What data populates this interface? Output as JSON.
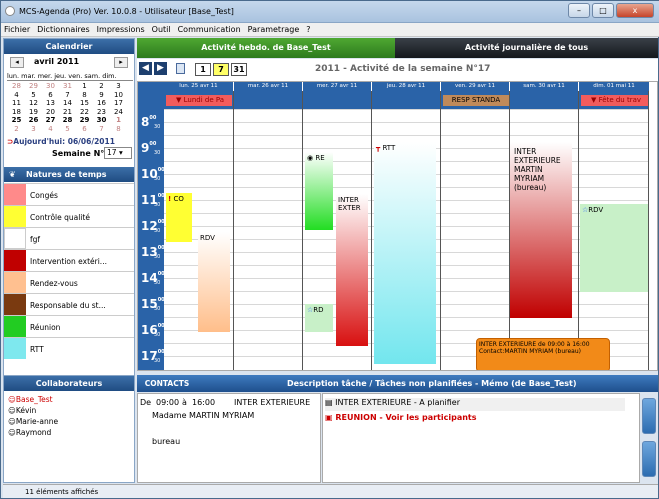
{
  "window": {
    "title": "MCS-Agenda (Pro) Ver. 10.0.8 - Utilisateur [Base_Test]",
    "min": "–",
    "max": "□",
    "close": "x"
  },
  "menu": [
    "Fichier",
    "Dictionnaires",
    "Impressions",
    "Outil",
    "Communication",
    "Parametrage",
    "?"
  ],
  "calendar": {
    "header": "Calendrier",
    "month": "avril 2011",
    "prev": "◂",
    "next": "▸",
    "dow": "lun. mar. mer. jeu. ven. sam. dim.",
    "weeks": [
      [
        "28",
        "29",
        "30",
        "31",
        "1",
        "2",
        "3"
      ],
      [
        "4",
        "5",
        "6",
        "7",
        "8",
        "9",
        "10"
      ],
      [
        "11",
        "12",
        "13",
        "14",
        "15",
        "16",
        "17"
      ],
      [
        "18",
        "19",
        "20",
        "21",
        "22",
        "23",
        "24"
      ],
      [
        "25",
        "26",
        "27",
        "28",
        "29",
        "30",
        "1"
      ],
      [
        "2",
        "3",
        "4",
        "5",
        "6",
        "7",
        "8"
      ]
    ],
    "today": "Aujourd'hui: 06/06/2011",
    "week_label": "Semaine N°",
    "week_value": "17"
  },
  "natures": {
    "header": "Natures de temps",
    "items": [
      {
        "label": "Congés",
        "color": "#ff8a8a"
      },
      {
        "label": "Contrôle qualité",
        "color": "#ffff33"
      },
      {
        "label": "fgf",
        "color": "#ffffff"
      },
      {
        "label": "Intervention extéri...",
        "color": "#c00000"
      },
      {
        "label": "Rendez-vous",
        "color": "#ffc090"
      },
      {
        "label": "Responsable du st...",
        "color": "#7a3a10"
      },
      {
        "label": "Réunion",
        "color": "#22cc22"
      },
      {
        "label": "RTT",
        "color": "#7ee8ee"
      }
    ]
  },
  "tabs": {
    "weekly": "Activité hebdo. de Base_Test",
    "daily": "Activité journalière de tous"
  },
  "toolbar": {
    "btn1": "1",
    "btn7": "7",
    "btn31": "31",
    "title": "2011 - Activité de la semaine N°17"
  },
  "schedule": {
    "days": [
      "lun. 25 avr 11",
      "mar. 26 avr 11",
      "mer. 27 avr 11",
      "jeu. 28 avr 11",
      "ven. 29 avr 11",
      "sam. 30 avr 11",
      "dim. 01 mai 11"
    ],
    "hours": [
      "8",
      "9",
      "10",
      "11",
      "12",
      "13",
      "14",
      "15",
      "16",
      "17"
    ],
    "minutes": "00",
    "half": "30",
    "banners": {
      "mon": "Lundi de Pa",
      "fri": "RESP STANDA",
      "sun": "Fête du trav"
    },
    "events": {
      "co": "CO",
      "rdv": "RDV",
      "re": "RE",
      "inter": "INTER EXTER",
      "rtt": "RTT",
      "rd": "RD",
      "inter2": "INTER EXTERIEURE MARTIN MYRIAM (bureau)",
      "rdv2": "RDV"
    },
    "tooltip": "INTER EXTERIEURE de 09:00 à 16:00 Contact:MARTIN MYRIAM (bureau)"
  },
  "collab": {
    "header": "Collaborateurs",
    "items": [
      "Base_Test",
      "Kévin",
      "Marie-anne",
      "Raymond"
    ]
  },
  "status": "11 éléments affichés",
  "bottom": {
    "contacts": "CONTACTS",
    "desc_header": "Description tâche  /  Tâches non planifiées - Mémo (de Base_Test)",
    "de": "De",
    "from": "09:00",
    "a": "à",
    "to": "16:00",
    "type": "INTER EXTERIEURE",
    "contact": "Madame MARTIN MYRIAM",
    "place": "bureau",
    "task1": "INTER EXTERIEURE - A planifier",
    "task2": "REUNION - Voir les participants"
  }
}
